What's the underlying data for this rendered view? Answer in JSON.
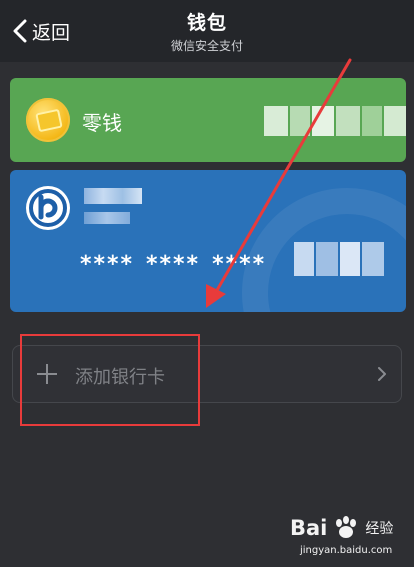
{
  "header": {
    "back_label": "返回",
    "title": "钱包",
    "subtitle": "微信安全支付"
  },
  "change_card": {
    "label": "零钱",
    "color": "#58a653"
  },
  "bank_card": {
    "masked_groups": [
      "****",
      "****",
      "****"
    ],
    "color": "#2a72b9"
  },
  "add_card": {
    "label": "添加银行卡"
  },
  "annotation": {
    "color": "#e83b3b"
  },
  "watermark": {
    "brand_prefix": "Bai",
    "brand_suffix": "经验",
    "url": "jingyan.baidu.com"
  }
}
